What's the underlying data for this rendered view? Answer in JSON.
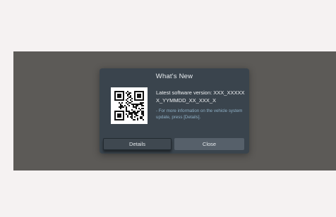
{
  "dialog": {
    "title": "What's New",
    "version_text": "Latest software version: XXX_XXXXXX_YYMMDD_XX_XXX_X",
    "note_text": "- For more information on the vehicle system update, press [Details].",
    "qr_icon": "qr-code-icon"
  },
  "buttons": {
    "details_label": "Details",
    "close_label": "Close"
  },
  "colors": {
    "page_background": "#f5f2f2",
    "screen_background": "#5c5a57",
    "dialog_background": "#3a444d",
    "note_text": "#8fb0c6"
  }
}
